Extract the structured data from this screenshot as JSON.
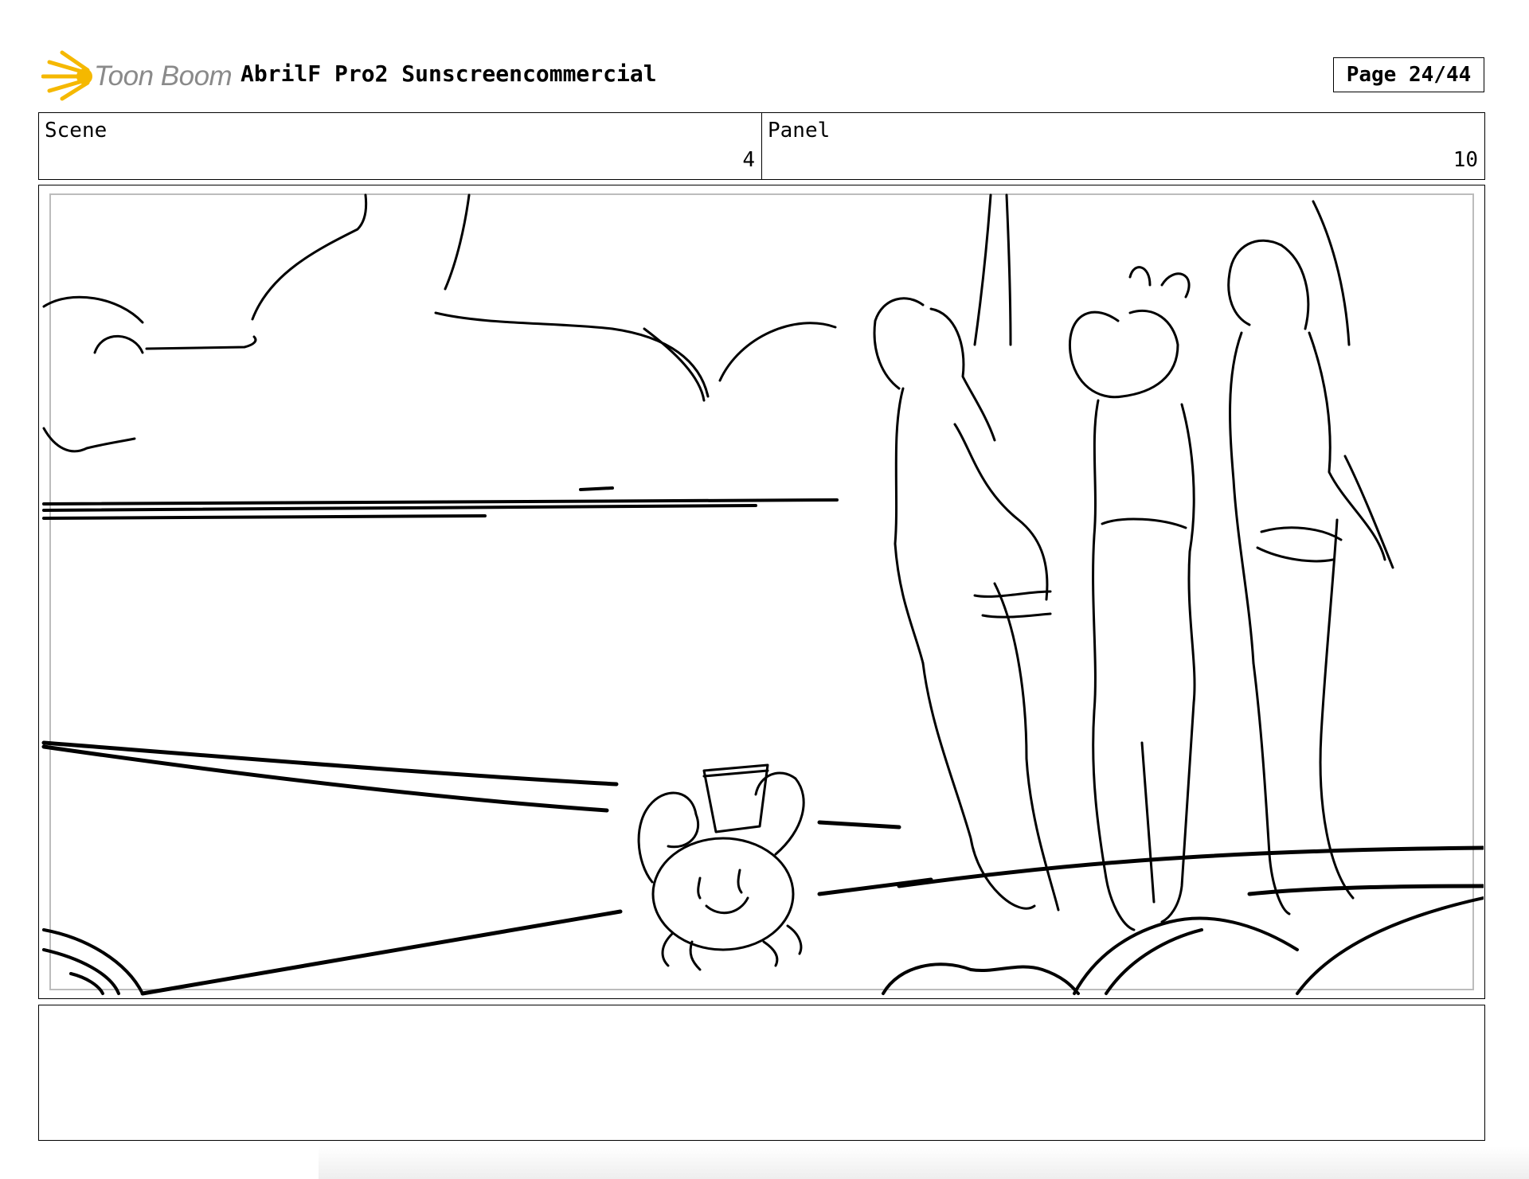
{
  "header": {
    "logo_text": "Toon Boom",
    "title": "AbrilF Pro2 Sunscreencommercial",
    "page_label": "Page 24/44"
  },
  "info": {
    "scene_label": "Scene",
    "scene_value": "4",
    "panel_label": "Panel",
    "panel_value": "10"
  },
  "colors": {
    "logo_star": "#f5b800",
    "logo_text": "#8a8a8a",
    "frame_inner_border": "#bcbcbc"
  }
}
